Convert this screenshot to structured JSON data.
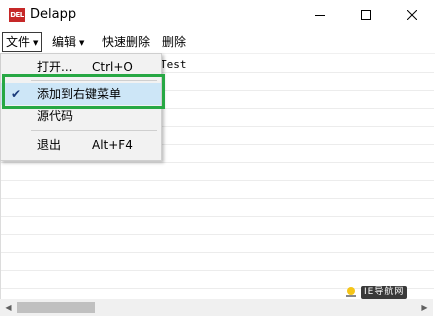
{
  "window": {
    "icon_text": "DEL",
    "title": "Delapp"
  },
  "menubar": {
    "items": [
      {
        "label": "文件",
        "has_arrow": true
      },
      {
        "label": "编辑",
        "has_arrow": true
      },
      {
        "label": "快速删除",
        "has_arrow": false
      },
      {
        "label": "删除",
        "has_arrow": false
      }
    ],
    "arrow_glyph": "▼"
  },
  "editor": {
    "text": "Test"
  },
  "file_menu": {
    "items": [
      {
        "label": "打开...",
        "shortcut": "Ctrl+O",
        "checked": false
      },
      {
        "label": "添加到右键菜单",
        "shortcut": "",
        "checked": true
      },
      {
        "label": "源代码",
        "shortcut": "",
        "checked": false
      },
      {
        "label": "退出",
        "shortcut": "Alt+F4",
        "checked": false
      }
    ],
    "check_glyph": "✔"
  },
  "watermark": {
    "text": "IE导航网"
  },
  "colors": {
    "highlight_border": "#27a844",
    "menu_hover": "#cde6f7",
    "icon_bg": "#c62828"
  }
}
